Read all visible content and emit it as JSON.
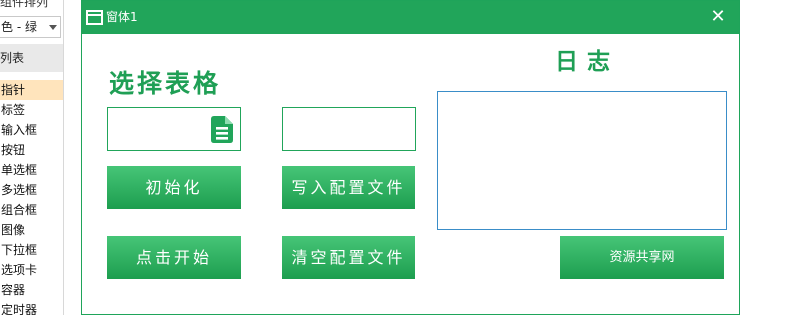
{
  "ide_panel": {
    "cut_title": "组件排列",
    "color_select": "色 - 绿",
    "section_label": "列表",
    "components": [
      "指针",
      "标签",
      "输入框",
      "按钮",
      "单选框",
      "多选框",
      "组合框",
      "图像",
      "下拉框",
      "选项卡",
      "容器",
      "定时器"
    ],
    "selected_component": "指针"
  },
  "window": {
    "title": "窗体1",
    "close_label": "✕",
    "accent_color": "#21a55a"
  },
  "main": {
    "table_heading": "选择表格",
    "log_heading": "日志",
    "table_field_value": "",
    "config_field_value": "",
    "log_text": "",
    "buttons": {
      "init": "初始化",
      "write_config": "写入配置文件",
      "start": "点击开始",
      "clear_config": "清空配置文件",
      "share": "资源共享网"
    }
  }
}
